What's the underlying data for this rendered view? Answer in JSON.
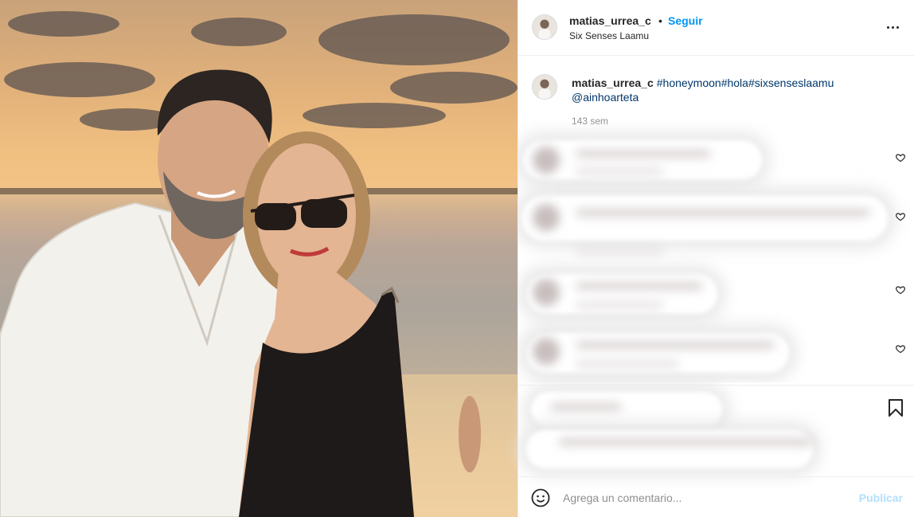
{
  "post": {
    "photo_icon": "post-photo-couple-sunset"
  },
  "header": {
    "username": "matias_urrea_c",
    "dot": "•",
    "follow_label": "Seguir",
    "location": "Six Senses Laamu",
    "more_icon": "more-options-icon"
  },
  "caption": {
    "username": "matias_urrea_c",
    "tags": [
      "#honeymoon",
      "#hola",
      "#sixsenseslaamu"
    ],
    "mention": "@ainhoarteta",
    "time": "143 sem"
  },
  "comments": {
    "note": "",
    "heart_icon": "heart-icon"
  },
  "actions": {
    "bookmark_icon": "bookmark-icon"
  },
  "composer": {
    "emoji_icon": "emoji-icon",
    "placeholder": "Agrega un comentario...",
    "publish_label": "Publicar"
  },
  "colors": {
    "accent": "#0095f6",
    "publish_disabled": "#b2dffc",
    "tag": "#00376b",
    "muted": "#8e8e8e"
  }
}
